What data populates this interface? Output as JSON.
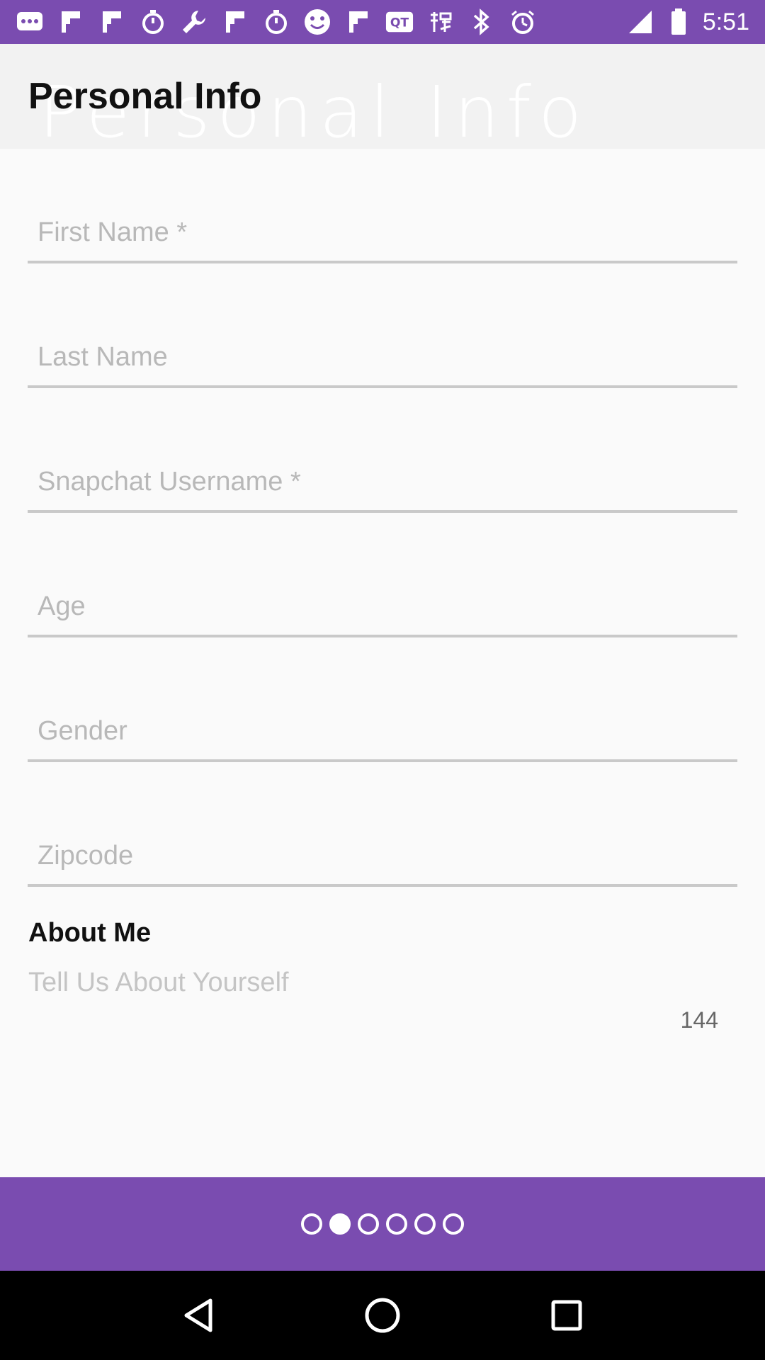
{
  "status_bar": {
    "time": "5:51",
    "icons": [
      "chat-bubble-icon",
      "flipboard-icon",
      "flipboard-icon",
      "timer-icon",
      "wrench-icon",
      "flipboard-icon",
      "timer-icon",
      "smiley-icon",
      "flipboard-icon",
      "qt-icon",
      "taobao-icon",
      "bluetooth-icon",
      "alarm-icon",
      "signal-icon",
      "battery-icon"
    ]
  },
  "header": {
    "title": "Personal Info",
    "ghost_title": "Personal  Info"
  },
  "form": {
    "first_name": {
      "placeholder": "First Name *",
      "value": ""
    },
    "last_name": {
      "placeholder": "Last Name",
      "value": ""
    },
    "snapchat": {
      "placeholder": "Snapchat Username *",
      "value": ""
    },
    "age": {
      "placeholder": "Age",
      "value": ""
    },
    "gender": {
      "placeholder": "Gender",
      "value": ""
    },
    "zipcode": {
      "placeholder": "Zipcode",
      "value": ""
    }
  },
  "about": {
    "label": "About Me",
    "placeholder": "Tell Us About Yourself",
    "char_count": "144"
  },
  "pager": {
    "total_pages": 6,
    "current_page": 2
  },
  "colors": {
    "accent": "#7a4cb0",
    "background": "#fafafa",
    "header_bg": "#f2f2f2",
    "underline": "#c9c9c9"
  }
}
